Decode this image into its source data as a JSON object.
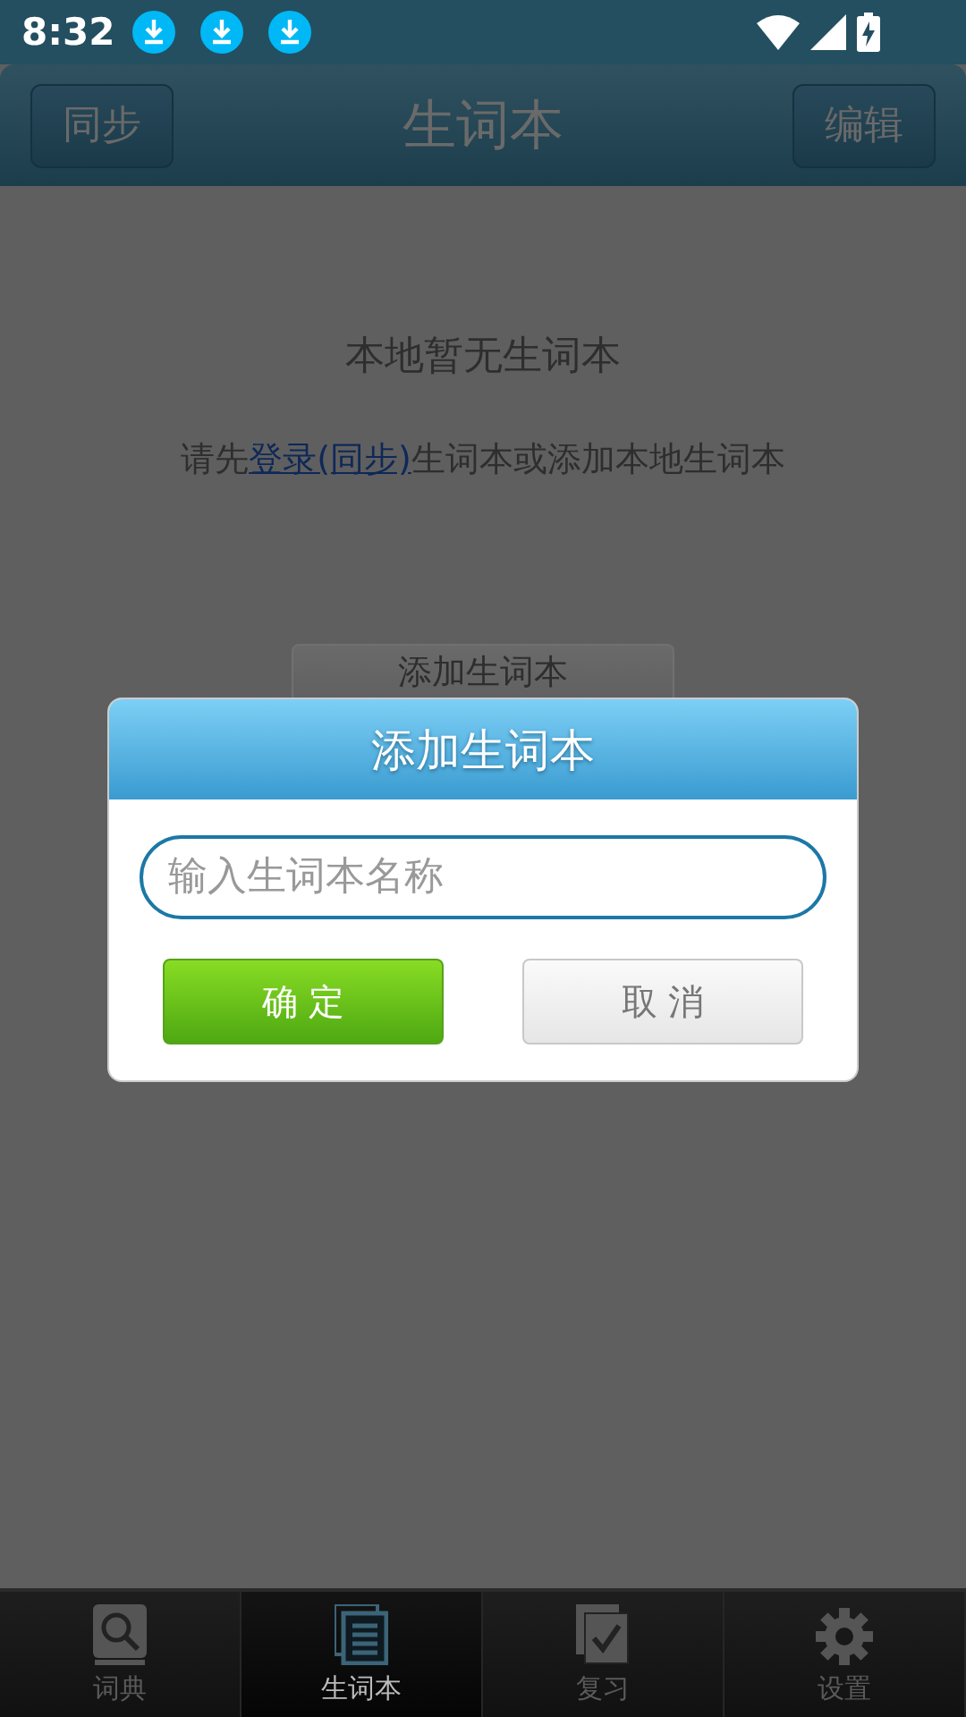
{
  "status_bar": {
    "time": "8:32"
  },
  "header": {
    "left_button": "同步",
    "title": "生词本",
    "right_button": "编辑"
  },
  "empty_state": {
    "message": "本地暂无生词本",
    "hint": {
      "before": "请先",
      "link": "登录(同步)",
      "after": "生词本或添加本地生词本"
    },
    "button": "添加生词本"
  },
  "dialog": {
    "title": "添加生词本",
    "input": {
      "placeholder": "输入生词本名称"
    },
    "confirm_button": "确 定",
    "cancel_button": "取 消"
  },
  "tabs": [
    {
      "label": "词典",
      "selected": false
    },
    {
      "label": "生词本",
      "selected": true
    },
    {
      "label": "复习",
      "selected": false
    },
    {
      "label": "设置",
      "selected": false
    }
  ]
}
